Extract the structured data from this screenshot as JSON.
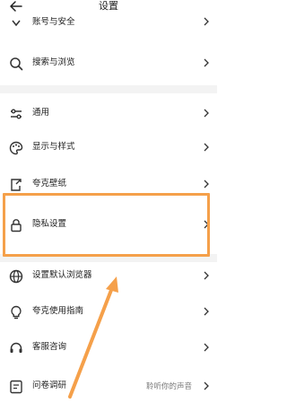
{
  "header": {
    "title": "设置",
    "back_icon": "arrow-left-icon"
  },
  "rows": [
    {
      "id": "account-security",
      "label": "账号与安全",
      "icon": "shield-icon"
    },
    {
      "id": "search-browse",
      "label": "搜索与浏览",
      "icon": "search-icon"
    },
    {
      "id": "general",
      "label": "通用",
      "icon": "sliders-icon"
    },
    {
      "id": "display-style",
      "label": "显示与样式",
      "icon": "palette-icon"
    },
    {
      "id": "wallpaper",
      "label": "夸克壁纸",
      "icon": "wallpaper-icon"
    },
    {
      "id": "privacy",
      "label": "隐私设置",
      "icon": "lock-icon"
    },
    {
      "id": "default-browser",
      "label": "设置默认浏览器",
      "icon": "globe-icon"
    },
    {
      "id": "guide",
      "label": "夸克使用指南",
      "icon": "lightbulb-icon"
    },
    {
      "id": "support",
      "label": "客服咨询",
      "icon": "headset-icon"
    },
    {
      "id": "survey",
      "label": "问卷调研",
      "icon": "survey-icon",
      "hint": "聆听你的声音"
    }
  ],
  "annotation": {
    "highlight_color": "#f5a04a",
    "highlighted_row": "privacy"
  }
}
